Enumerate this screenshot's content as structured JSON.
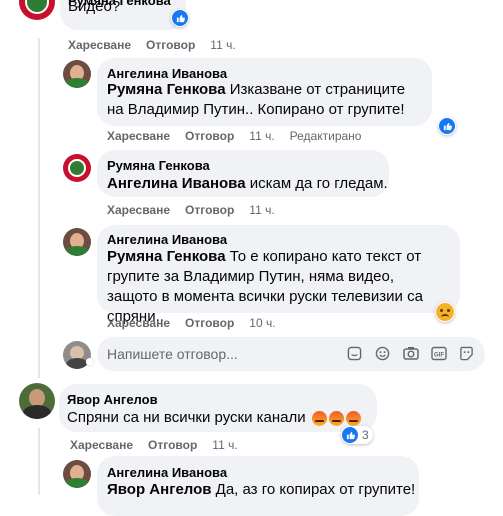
{
  "comments": [
    {
      "name": "Румяна Генкова",
      "text": "Видео?",
      "actions": {
        "like": "Харесване",
        "reply": "Отговор",
        "time": "11 ч."
      }
    },
    {
      "name": "Ангелина Иванова",
      "mention": "Румяна Генкова",
      "text": " Изказване от страниците на Владимир Путин.. Копирано от групите!",
      "actions": {
        "like": "Харесване",
        "reply": "Отговор",
        "time": "11 ч.",
        "edited": "Редактирано"
      }
    },
    {
      "name": "Румяна Генкова",
      "mention": "Ангелина Иванова",
      "text": " искам да го гледам.",
      "actions": {
        "like": "Харесване",
        "reply": "Отговор",
        "time": "11 ч."
      }
    },
    {
      "name": "Ангелина Иванова",
      "mention": "Румяна Генкова",
      "text": " То е копирано като текст от групите за Владимир Путин, няма видео, защото в момента всички руски телевизии са спряни..",
      "actions": {
        "like": "Харесване",
        "reply": "Отговор",
        "time": "10 ч."
      }
    },
    {
      "name": "Явор Ангелов",
      "text": "Спряни са ни всички руски канали",
      "reaction_count": "3",
      "actions": {
        "like": "Харесване",
        "reply": "Отговор",
        "time": "11 ч."
      }
    },
    {
      "name": "Ангелина Иванова",
      "mention": "Явор Ангелов",
      "text": " Да, аз го копирах от групите!"
    }
  ],
  "reply_input": {
    "placeholder": "Напишете отговор..."
  },
  "colors": {
    "like_blue": "#1877f2",
    "bubble_bg": "#f0f2f5",
    "secondary_text": "#65676b"
  }
}
